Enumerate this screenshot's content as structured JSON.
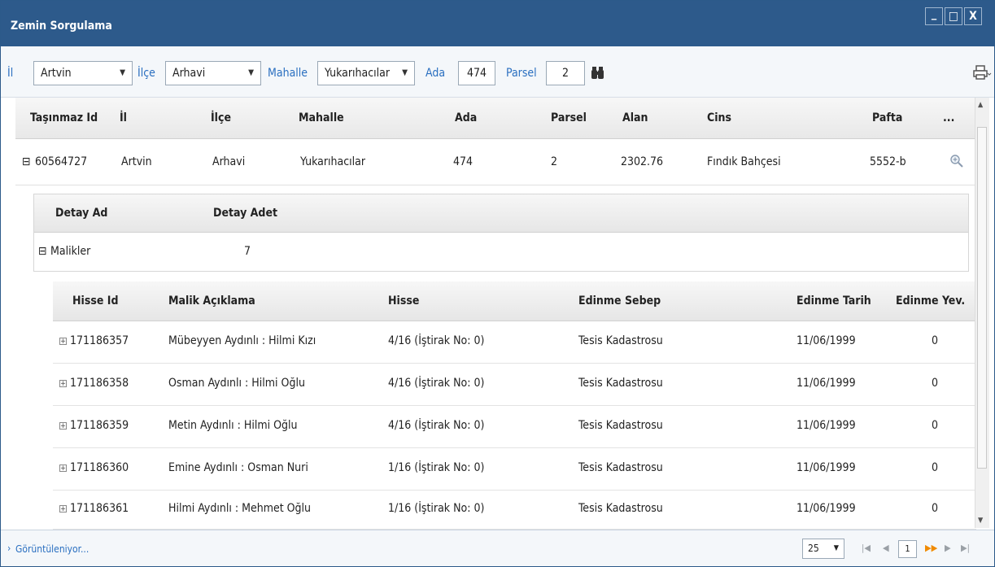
{
  "window": {
    "title": "Zemin Sorgulama",
    "controls": {
      "minimize": "_",
      "maximize": "□",
      "close": "X"
    }
  },
  "filters": {
    "il_label": "İl",
    "il_value": "Artvin",
    "ilce_label": "İlçe",
    "ilce_value": "Arhavi",
    "mahalle_label": "Mahalle",
    "mahalle_value": "Yukarıhacılar",
    "ada_label": "Ada",
    "ada_value": "474",
    "parsel_label": "Parsel",
    "parsel_value": "2",
    "search_icon": "binoculars-icon",
    "print_icon": "printer-icon"
  },
  "grid": {
    "headers": [
      "Taşınmaz Id",
      "İl",
      "İlçe",
      "Mahalle",
      "Ada",
      "Parsel",
      "Alan",
      "Cins",
      "Pafta",
      "..."
    ],
    "row": {
      "expander": "⊟",
      "tasinmaz_id": "60564727",
      "il": "Artvin",
      "ilce": "Arhavi",
      "mahalle": "Yukarıhacılar",
      "ada": "474",
      "parsel": "2",
      "alan": "2302.76",
      "cins": "Fındık Bahçesi",
      "pafta": "5552-b"
    }
  },
  "detail": {
    "headers": [
      "Detay Ad",
      "Detay Adet"
    ],
    "row": {
      "expander": "⊟",
      "ad": "Malikler",
      "adet": "7"
    }
  },
  "owners": {
    "headers": [
      "Hisse Id",
      "Malik Açıklama",
      "Hisse",
      "Edinme Sebep",
      "Edinme Tarih",
      "Edinme Yev."
    ],
    "rows": [
      {
        "expander": "+",
        "hisse_id": "171186357",
        "malik": "Mübeyyen Aydınlı : Hilmi Kızı",
        "hisse": "4/16 (İştirak No: 0)",
        "sebep": "Tesis Kadastrosu",
        "tarih": "11/06/1999",
        "yev": "0"
      },
      {
        "expander": "+",
        "hisse_id": "171186358",
        "malik": "Osman Aydınlı : Hilmi Oğlu",
        "hisse": "4/16 (İştirak No: 0)",
        "sebep": "Tesis Kadastrosu",
        "tarih": "11/06/1999",
        "yev": "0"
      },
      {
        "expander": "+",
        "hisse_id": "171186359",
        "malik": "Metin Aydınlı : Hilmi Oğlu",
        "hisse": "4/16 (İştirak No: 0)",
        "sebep": "Tesis Kadastrosu",
        "tarih": "11/06/1999",
        "yev": "0"
      },
      {
        "expander": "+",
        "hisse_id": "171186360",
        "malik": "Emine Aydınlı : Osman Nuri",
        "hisse": "1/16 (İştirak No: 0)",
        "sebep": "Tesis Kadastrosu",
        "tarih": "11/06/1999",
        "yev": "0"
      },
      {
        "expander": "+",
        "hisse_id": "171186361",
        "malik": "Hilmi Aydınlı : Mehmet Oğlu",
        "hisse": "1/16 (İştirak No: 0)",
        "sebep": "Tesis Kadastrosu",
        "tarih": "11/06/1999",
        "yev": "0"
      }
    ]
  },
  "status": {
    "text": "Görüntüleniyor...",
    "page_size": "25",
    "current_page": "1"
  },
  "colors": {
    "titlebar": "#2d5a8b",
    "label_blue": "#2a6fc0",
    "next_arrow": "#f08a00"
  }
}
